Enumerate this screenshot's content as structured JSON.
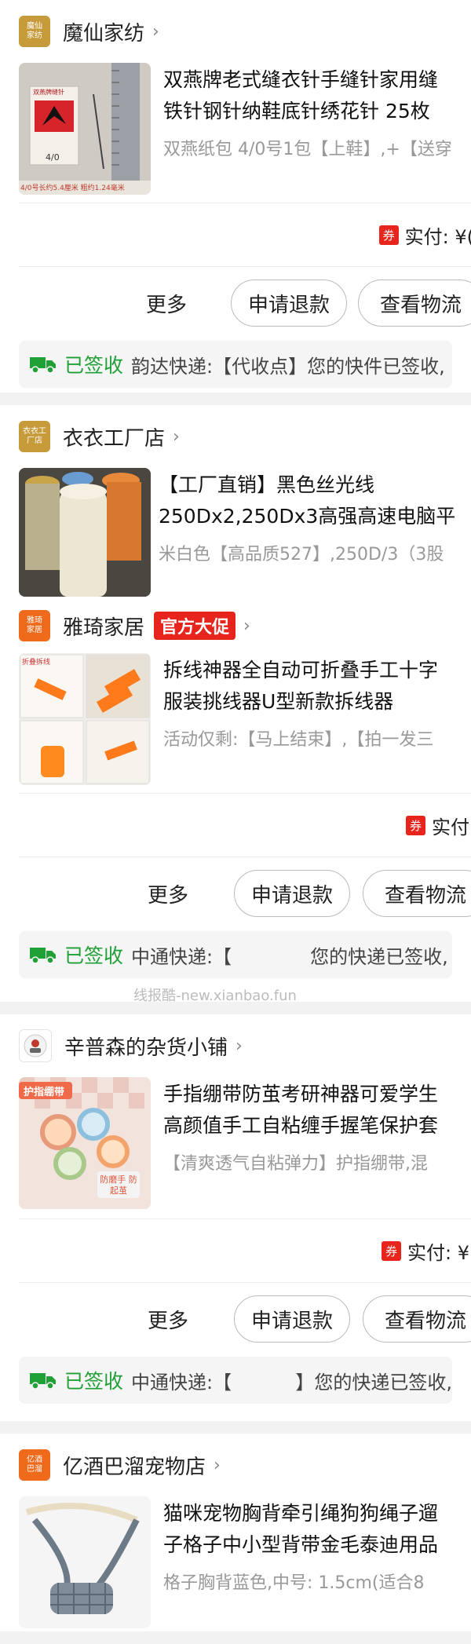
{
  "orders": [
    {
      "store": {
        "logo_text": "魔仙家纺",
        "name": "魔仙家纺",
        "logo_color": "#c79a3a"
      },
      "product": {
        "title_line1": "双燕牌老式缝衣针手缝针家用缝",
        "title_line2": "铁针钢针纳鞋底针绣花针 25枚",
        "spec": "双燕纸包 4/0号1包【上鞋】,+【送穿",
        "thumb_label": "双燕牌缝针",
        "thumb_caption": "4/0号长约5.4厘米  粗约1.24毫米",
        "thumb_num": "4/0"
      },
      "payment": {
        "coupon": "券",
        "label": "实付: ¥("
      },
      "actions": {
        "more": "更多",
        "refund": "申请退款",
        "logistics": "查看物流"
      },
      "delivery": {
        "status": "已签收",
        "text": "韵达快递:【代收点】您的快件已签收,"
      }
    },
    {
      "stores": [
        {
          "store": {
            "logo_text": "衣衣工厂店",
            "name": "衣衣工厂店",
            "logo_color": "#c79a3a"
          },
          "product": {
            "title_line1": "【工厂直销】黑色丝光线",
            "title_line2": "250Dx2,250Dx3高强高速电脑平",
            "spec": "米白色【高品质527】,250D/3（3股"
          }
        },
        {
          "store": {
            "logo_text": "雅琦家居",
            "name": "雅琦家居",
            "logo_color": "#ef6a1a",
            "badge": "官方大促"
          },
          "product": {
            "title_line1": "拆线神器全自动可折叠手工十字",
            "title_line2": "服装挑线器U型新款拆线器",
            "spec": "活动仅剩:【马上结束】,【拍一发三",
            "thumb_label": "折叠拆线"
          }
        }
      ],
      "payment": {
        "coupon": "券",
        "label": "实付"
      },
      "actions": {
        "more": "更多",
        "refund": "申请退款",
        "logistics": "查看物流"
      },
      "delivery": {
        "status": "已签收",
        "text": "中通快递:【",
        "text2": "您的快递已签收,"
      },
      "watermark": "线报酷-new.xianbao.fun"
    },
    {
      "store": {
        "name": "辛普森的杂货小铺"
      },
      "product": {
        "title_line1": "手指绷带防茧考研神器可爱学生",
        "title_line2": "高颜值手工自粘缠手握笔保护套",
        "spec": "【清爽透气自粘弹力】护指绷带,混",
        "thumb_label": "护指绷带",
        "thumb_note": "防磨手 防起茧"
      },
      "payment": {
        "coupon": "券",
        "label": "实付: ¥"
      },
      "actions": {
        "more": "更多",
        "refund": "申请退款",
        "logistics": "查看物流"
      },
      "delivery": {
        "status": "已签收",
        "text": "中通快递:【",
        "text2": "】您的快递已签收,"
      }
    },
    {
      "store": {
        "logo_text": "亿酒巴溜",
        "name": "亿酒巴溜宠物店",
        "logo_color": "#ef6a1a"
      },
      "product": {
        "title_line1": "猫咪宠物胸背牵引绳狗狗绳子遛",
        "title_line2": "子格子中小型背带金毛泰迪用品",
        "spec": "格子胸背蓝色,中号: 1.5cm(适合8"
      }
    }
  ]
}
